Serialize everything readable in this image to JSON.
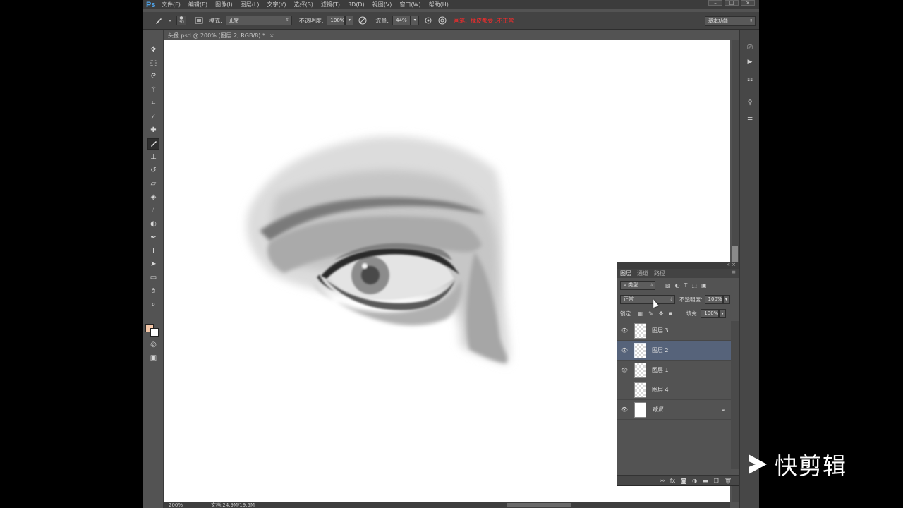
{
  "app": {
    "logo": "Ps",
    "menu": [
      "文件(F)",
      "编辑(E)",
      "图像(I)",
      "图层(L)",
      "文字(Y)",
      "选择(S)",
      "滤镜(T)",
      "3D(D)",
      "视图(V)",
      "窗口(W)",
      "帮助(H)"
    ],
    "window_controls": [
      "–",
      "□",
      "×"
    ]
  },
  "options_bar": {
    "brush_size": "30",
    "mode_label": "模式:",
    "mode_value": "正常",
    "opacity_label": "不透明度:",
    "opacity_value": "100%",
    "flow_label": "流量:",
    "flow_value": "44%",
    "note": "画笔、橡皮都要 :不正常",
    "workspace": "基本功能"
  },
  "document": {
    "tab_title": "头像.psd @ 200% (图层 2, RGB/8) *",
    "tab_close": "×",
    "zoom": "200%",
    "doc_size": "文档:24.9M/19.5M"
  },
  "toolbar": {
    "icons": [
      "move-icon",
      "marquee-icon",
      "lasso-icon",
      "magic-wand-icon",
      "crop-icon",
      "eyedropper-icon",
      "healing-brush-icon",
      "brush-icon",
      "clone-stamp-icon",
      "history-brush-icon",
      "eraser-icon",
      "paint-bucket-icon",
      "blur-icon",
      "dodge-icon",
      "pen-icon",
      "type-icon",
      "path-select-icon",
      "rectangle-icon",
      "hand-icon",
      "zoom-icon"
    ],
    "active": "brush-icon",
    "foreground_color": "#f5c7a8",
    "background_color": "#ffffff"
  },
  "layers_panel": {
    "tabs": [
      "图层",
      "通道",
      "路径"
    ],
    "active_tab": "图层",
    "filter_kind": "类型",
    "blend_mode": "正常",
    "opacity_label": "不透明度:",
    "opacity_value": "100%",
    "lock_label": "锁定:",
    "fill_label": "填充:",
    "fill_value": "100%",
    "layers": [
      {
        "name": "图层 3",
        "visible": true,
        "selected": false
      },
      {
        "name": "图层 2",
        "visible": true,
        "selected": true
      },
      {
        "name": "图层 1",
        "visible": true,
        "selected": false
      },
      {
        "name": "图层 4",
        "visible": false,
        "selected": false
      },
      {
        "name": "背景",
        "visible": true,
        "selected": false,
        "locked": true
      }
    ],
    "footer_icons": [
      "link-icon",
      "fx-icon",
      "mask-icon",
      "adjustment-icon",
      "group-icon",
      "new-layer-icon",
      "delete-icon"
    ]
  },
  "watermark": {
    "text": "快剪辑"
  },
  "colors": {
    "selected_layer": "#56637a",
    "note_red": "#ff2a2a",
    "ps_blue": "#4fa3e8"
  }
}
